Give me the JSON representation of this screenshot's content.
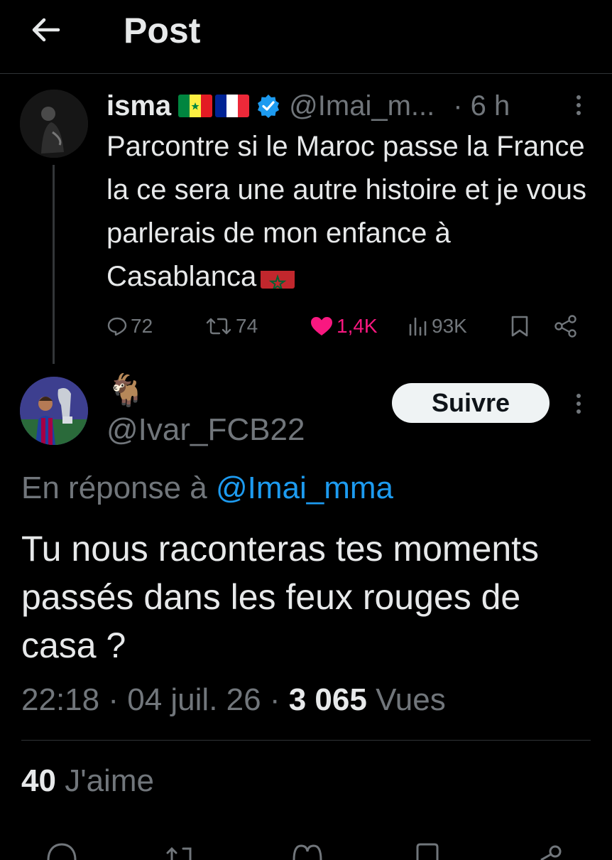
{
  "header": {
    "title": "Post",
    "back_icon": "arrow-left-icon"
  },
  "parent_tweet": {
    "author_name": "isma",
    "flags": [
      "flag-senegal",
      "flag-france"
    ],
    "handle": "@Imai_m...",
    "time": "· 6 h",
    "text": "Parcontre si le Maroc passe la France la ce sera une autre histoire et je vous parlerais de mon enfance à Casablanca",
    "text_flag": "flag-morocco",
    "stats": {
      "replies": "72",
      "reposts": "74",
      "likes": "1,4K",
      "views": "93K"
    }
  },
  "reply": {
    "display_name": "🐐",
    "handle": "@Ivar_FCB22",
    "follow_label": "Suivre",
    "replying_prefix": "En réponse à",
    "replying_to": "@Imai_mma",
    "text": "Tu nous raconteras tes moments passés dans les feux rouges de casa ?",
    "time": "22:18",
    "date": "04 juil. 26",
    "views_count": "3 065",
    "views_label": "Vues",
    "likes_count": "40",
    "likes_label": "J'aime"
  },
  "colors": {
    "background": "#000000",
    "accent": "#1d9bf0",
    "like": "#f91880",
    "muted": "#71767b"
  }
}
